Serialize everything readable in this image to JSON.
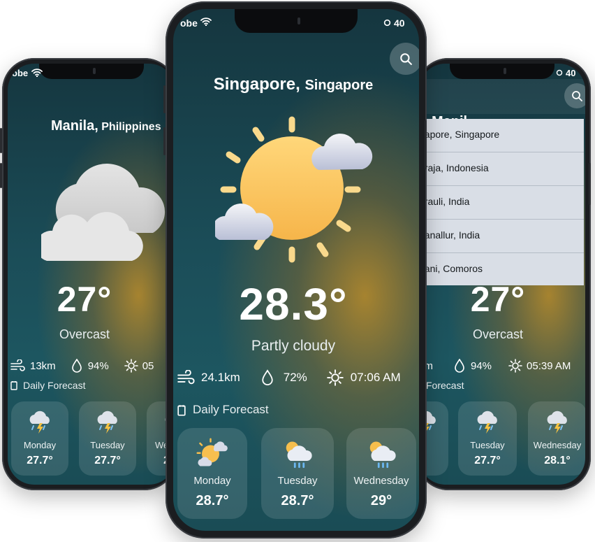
{
  "left_phone": {
    "status_left": "obe",
    "city_name": "Manila,",
    "country": "Philippines",
    "temperature": "27°",
    "condition": "Overcast",
    "wind": "13km",
    "humidity": "94%",
    "sunrise_partial": "05",
    "daily_label": "Daily Forecast",
    "forecast": [
      {
        "day": "Monday",
        "temp": "27.7°",
        "icon": "thunderstorm-icon"
      },
      {
        "day": "Tuesday",
        "temp": "27.7°",
        "icon": "thunderstorm-icon"
      },
      {
        "day": "We",
        "temp": "2",
        "icon": "thunderstorm-icon"
      }
    ]
  },
  "center_phone": {
    "status_left": "obe",
    "status_right": "40",
    "city_name": "Singapore,",
    "country": "Singapore",
    "temperature": "28.3°",
    "condition": "Partly cloudy",
    "wind": "24.1km",
    "humidity": "72%",
    "sunrise": "07:06 AM",
    "daily_label": "Daily Forecast",
    "forecast": [
      {
        "day": "Monday",
        "temp": "28.7°",
        "icon": "partly-cloudy-icon"
      },
      {
        "day": "Tuesday",
        "temp": "28.7°",
        "icon": "rain-sun-icon"
      },
      {
        "day": "Wednesday",
        "temp": "29°",
        "icon": "rain-sun-icon"
      }
    ]
  },
  "right_phone": {
    "status_right": "40",
    "city_partial": "Manil",
    "search_results": [
      "gapore, Singapore",
      "araja, Indonesia",
      "arauli, India",
      "ganallur, India",
      "gani, Comoros"
    ],
    "temperature": "27°",
    "condition": "Overcast",
    "wind": "km",
    "humidity": "94%",
    "sunrise": "05:39 AM",
    "daily_label": "Forecast",
    "forecast": [
      {
        "day": "lay",
        "temp": "7°",
        "icon": "thunderstorm-icon"
      },
      {
        "day": "Tuesday",
        "temp": "27.7°",
        "icon": "thunderstorm-icon"
      },
      {
        "day": "Wednesday",
        "temp": "28.1°",
        "icon": "thunderstorm-icon"
      }
    ]
  }
}
